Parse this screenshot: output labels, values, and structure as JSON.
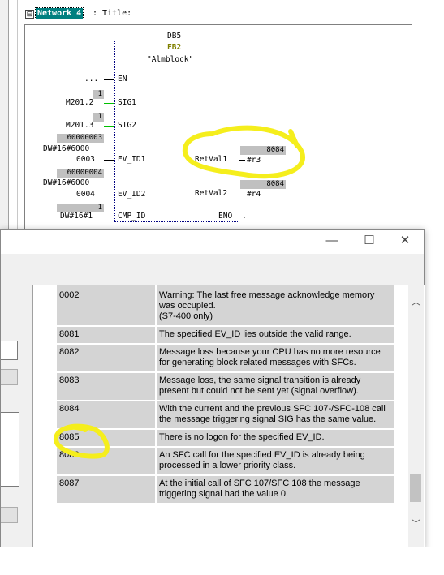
{
  "network": {
    "expander": "⊟",
    "label": "Network 4",
    "title": ": Title:"
  },
  "block": {
    "db": "DB5",
    "fb": "FB2",
    "name": "\"Almblock\"",
    "pins_in": [
      {
        "label": "EN",
        "wire": "...",
        "value": ""
      },
      {
        "label": "SIG1",
        "value_box": "1",
        "wire": "M201.2"
      },
      {
        "label": "SIG2",
        "value_box": "1",
        "wire": "M201.3"
      },
      {
        "label": "EV_ID1",
        "value_box": "60000003",
        "wire_top": "DW#16#6000",
        "wire": "0003"
      },
      {
        "label": "EV_ID2",
        "value_box": "60000004",
        "wire_top": "DW#16#6000",
        "wire": "0004"
      },
      {
        "label": "CMP_ID",
        "value_box": "1",
        "wire": "DW#16#1"
      }
    ],
    "pins_out": [
      {
        "label": "RetVal1",
        "value_box": "8084",
        "wire": "#r3"
      },
      {
        "label": "RetVal2",
        "value_box": "8084",
        "wire": "#r4"
      },
      {
        "label": "ENO",
        "wire": "."
      }
    ],
    "highlight_color": "#f5ee1c"
  },
  "help_window": {
    "buttons": {
      "minimize": "—",
      "maximize": "☐",
      "close": "✕"
    },
    "scroll": {
      "up": "︿",
      "down": "﹀"
    },
    "partial_top_text": "only)",
    "rows": [
      {
        "code": "0002",
        "desc": "Warning: The last free message acknowledge memory was occupied.\n(S7-400 only)"
      },
      {
        "code": "8081",
        "desc": "The specified EV_ID lies outside the valid range."
      },
      {
        "code": "8082",
        "desc": "Message loss because your CPU has no more resource for generating block related messages with SFCs."
      },
      {
        "code": "8083",
        "desc": "Message loss, the same signal transition is already present but could not be sent yet (signal overflow)."
      },
      {
        "code": "8084",
        "desc": "With the current and the previous SFC 107-/SFC-108 call the message triggering signal SIG has the same value."
      },
      {
        "code": "8085",
        "desc": "There is no logon for the specified EV_ID."
      },
      {
        "code": "8086",
        "desc": "An SFC call for the specified EV_ID is already being processed in a lower priority class."
      },
      {
        "code": "8087",
        "desc": "At the initial call of SFC 107/SFC 108 the message triggering signal had the value 0."
      }
    ]
  }
}
